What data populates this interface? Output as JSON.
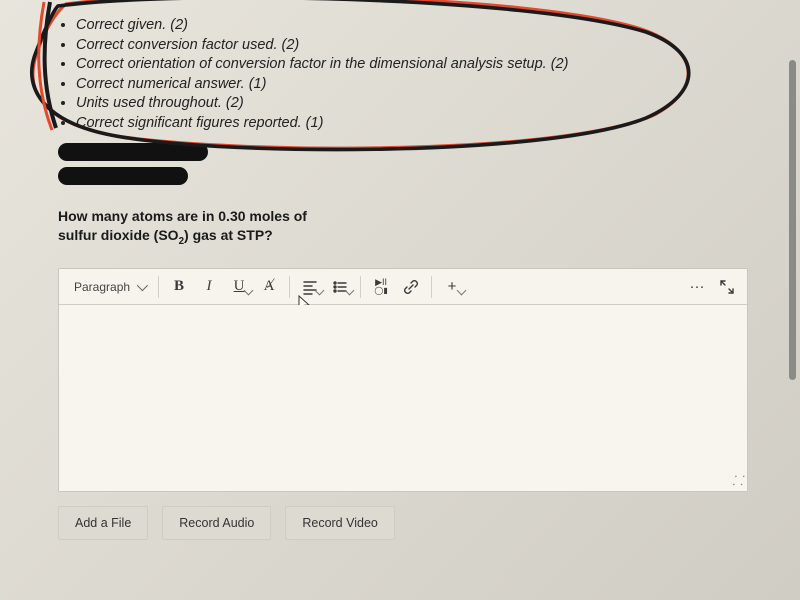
{
  "rubric": {
    "items": [
      "Correct given. (2)",
      "Correct conversion factor used. (2)",
      "Correct orientation of conversion factor in the dimensional analysis setup. (2)",
      "Correct numerical answer. (1)",
      "Units used throughout. (2)",
      "Correct significant figures reported. (1)"
    ]
  },
  "question": {
    "line1": "How many atoms are in 0.30 moles of",
    "line2_prefix": "sulfur dioxide (SO",
    "line2_sub": "2",
    "line2_suffix": ") gas at STP?"
  },
  "toolbar": {
    "style_select": "Paragraph",
    "bold": "B",
    "italic": "I",
    "underline": "U",
    "clear_format": "A",
    "clear_format_slash": "⁄",
    "media": "▶II",
    "media_sub": "◯▮",
    "plus": "+",
    "more": "···"
  },
  "attachments": {
    "add_file": "Add a File",
    "record_audio": "Record Audio",
    "record_video": "Record Video"
  }
}
